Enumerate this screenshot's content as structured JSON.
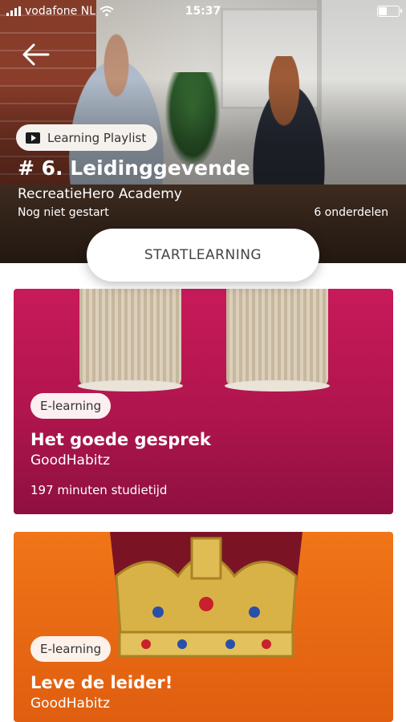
{
  "status_bar": {
    "carrier": "vodafone NL",
    "time": "15:37"
  },
  "hero": {
    "type_label": "Learning Playlist",
    "title": "# 6. Leidinggevende",
    "organization": "RecreatieHero Academy",
    "progress_status": "Nog niet gestart",
    "parts_count": "6 onderdelen"
  },
  "start_button": {
    "label": "STARTLEARNING"
  },
  "courses": [
    {
      "badge": "E-learning",
      "title": "Het goede gesprek",
      "provider": "GoodHabitz",
      "duration": "197 minuten studietijd",
      "color": "#c81a5a",
      "illustration": "coffee-cups"
    },
    {
      "badge": "E-learning",
      "title": "Leve de leider!",
      "provider": "GoodHabitz",
      "color": "#f07518",
      "illustration": "crown"
    }
  ],
  "icons": {
    "back": "arrow-left-icon",
    "signal": "signal-icon",
    "wifi": "wifi-icon",
    "battery": "battery-icon",
    "playlist": "play-icon"
  }
}
